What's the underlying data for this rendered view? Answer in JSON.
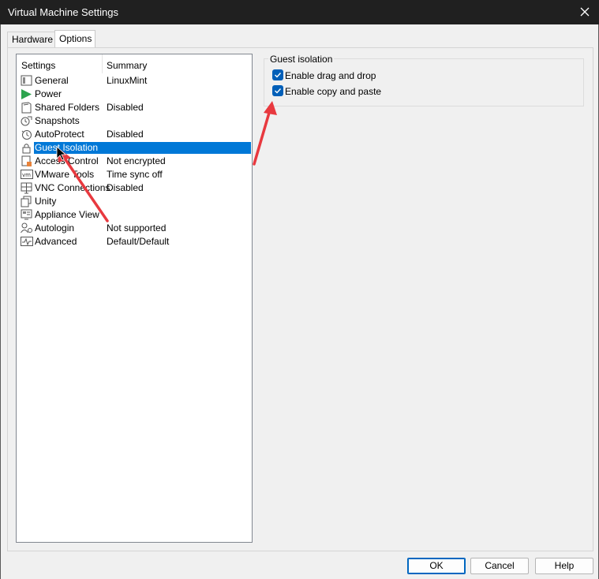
{
  "window": {
    "title": "Virtual Machine Settings"
  },
  "tabs": [
    {
      "label": "Hardware"
    },
    {
      "label": "Options"
    }
  ],
  "settings": {
    "header": {
      "settings": "Settings",
      "summary": "Summary"
    },
    "items": [
      {
        "label": "General",
        "summary": "LinuxMint",
        "icon": "general-icon"
      },
      {
        "label": "Power",
        "summary": "",
        "icon": "power-play-icon"
      },
      {
        "label": "Shared Folders",
        "summary": "Disabled",
        "icon": "shared-folders-icon"
      },
      {
        "label": "Snapshots",
        "summary": "",
        "icon": "snapshots-icon"
      },
      {
        "label": "AutoProtect",
        "summary": "Disabled",
        "icon": "autoprotect-clock-icon"
      },
      {
        "label": "Guest Isolation",
        "summary": "",
        "icon": "lock-icon",
        "selected": true
      },
      {
        "label": "Access Control",
        "summary": "Not encrypted",
        "icon": "access-control-icon"
      },
      {
        "label": "VMware Tools",
        "summary": "Time sync off",
        "icon": "vmware-tools-icon"
      },
      {
        "label": "VNC Connections",
        "summary": "Disabled",
        "icon": "vnc-icon"
      },
      {
        "label": "Unity",
        "summary": "",
        "icon": "unity-icon"
      },
      {
        "label": "Appliance View",
        "summary": "",
        "icon": "appliance-view-icon"
      },
      {
        "label": "Autologin",
        "summary": "Not supported",
        "icon": "autologin-icon"
      },
      {
        "label": "Advanced",
        "summary": "Default/Default",
        "icon": "advanced-icon"
      }
    ]
  },
  "guest_isolation": {
    "group_title": "Guest isolation",
    "options": [
      {
        "label": "Enable drag and drop",
        "checked": true
      },
      {
        "label": "Enable copy and paste",
        "checked": true
      }
    ]
  },
  "buttons": {
    "ok": "OK",
    "cancel": "Cancel",
    "help": "Help"
  },
  "colors": {
    "selection": "#0078d7",
    "checkbox": "#005fb8",
    "annotation_arrow": "#e8393f"
  }
}
